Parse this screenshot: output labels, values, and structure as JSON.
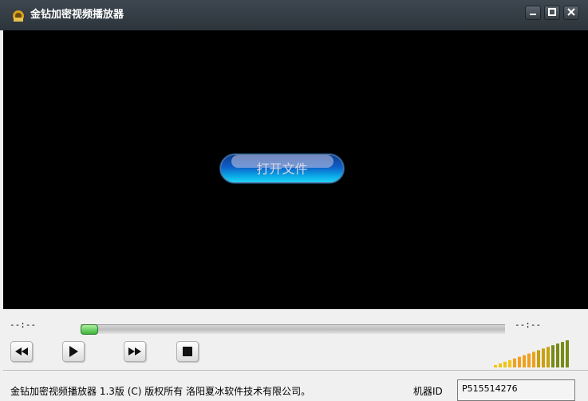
{
  "window": {
    "title": "金钻加密视频播放器",
    "minimize_icon": "minimize-icon",
    "maximize_icon": "maximize-icon",
    "close_icon": "close-icon"
  },
  "video": {
    "open_button_label": "打开文件",
    "background": "#000000"
  },
  "playback": {
    "current_time": "--:--",
    "total_time": "--:--",
    "progress": 0,
    "controls": [
      {
        "name": "rewind",
        "icon": "rewind-icon"
      },
      {
        "name": "play",
        "icon": "play-icon"
      },
      {
        "name": "fast-forward",
        "icon": "fast-forward-icon"
      },
      {
        "name": "stop",
        "icon": "stop-icon"
      }
    ],
    "volume_bars": 16,
    "volume_level": 1.0
  },
  "statusbar": {
    "copyright": "金钻加密视频播放器 1.3版 (C) 版权所有 洛阳夏冰软件技术有限公司。",
    "machine_id_label": "机器ID",
    "machine_id_value": "P515514276"
  },
  "colors": {
    "titlebar": "#2c343b",
    "progress_thumb": "#3cb43a",
    "open_button": "#0e5fc8"
  }
}
